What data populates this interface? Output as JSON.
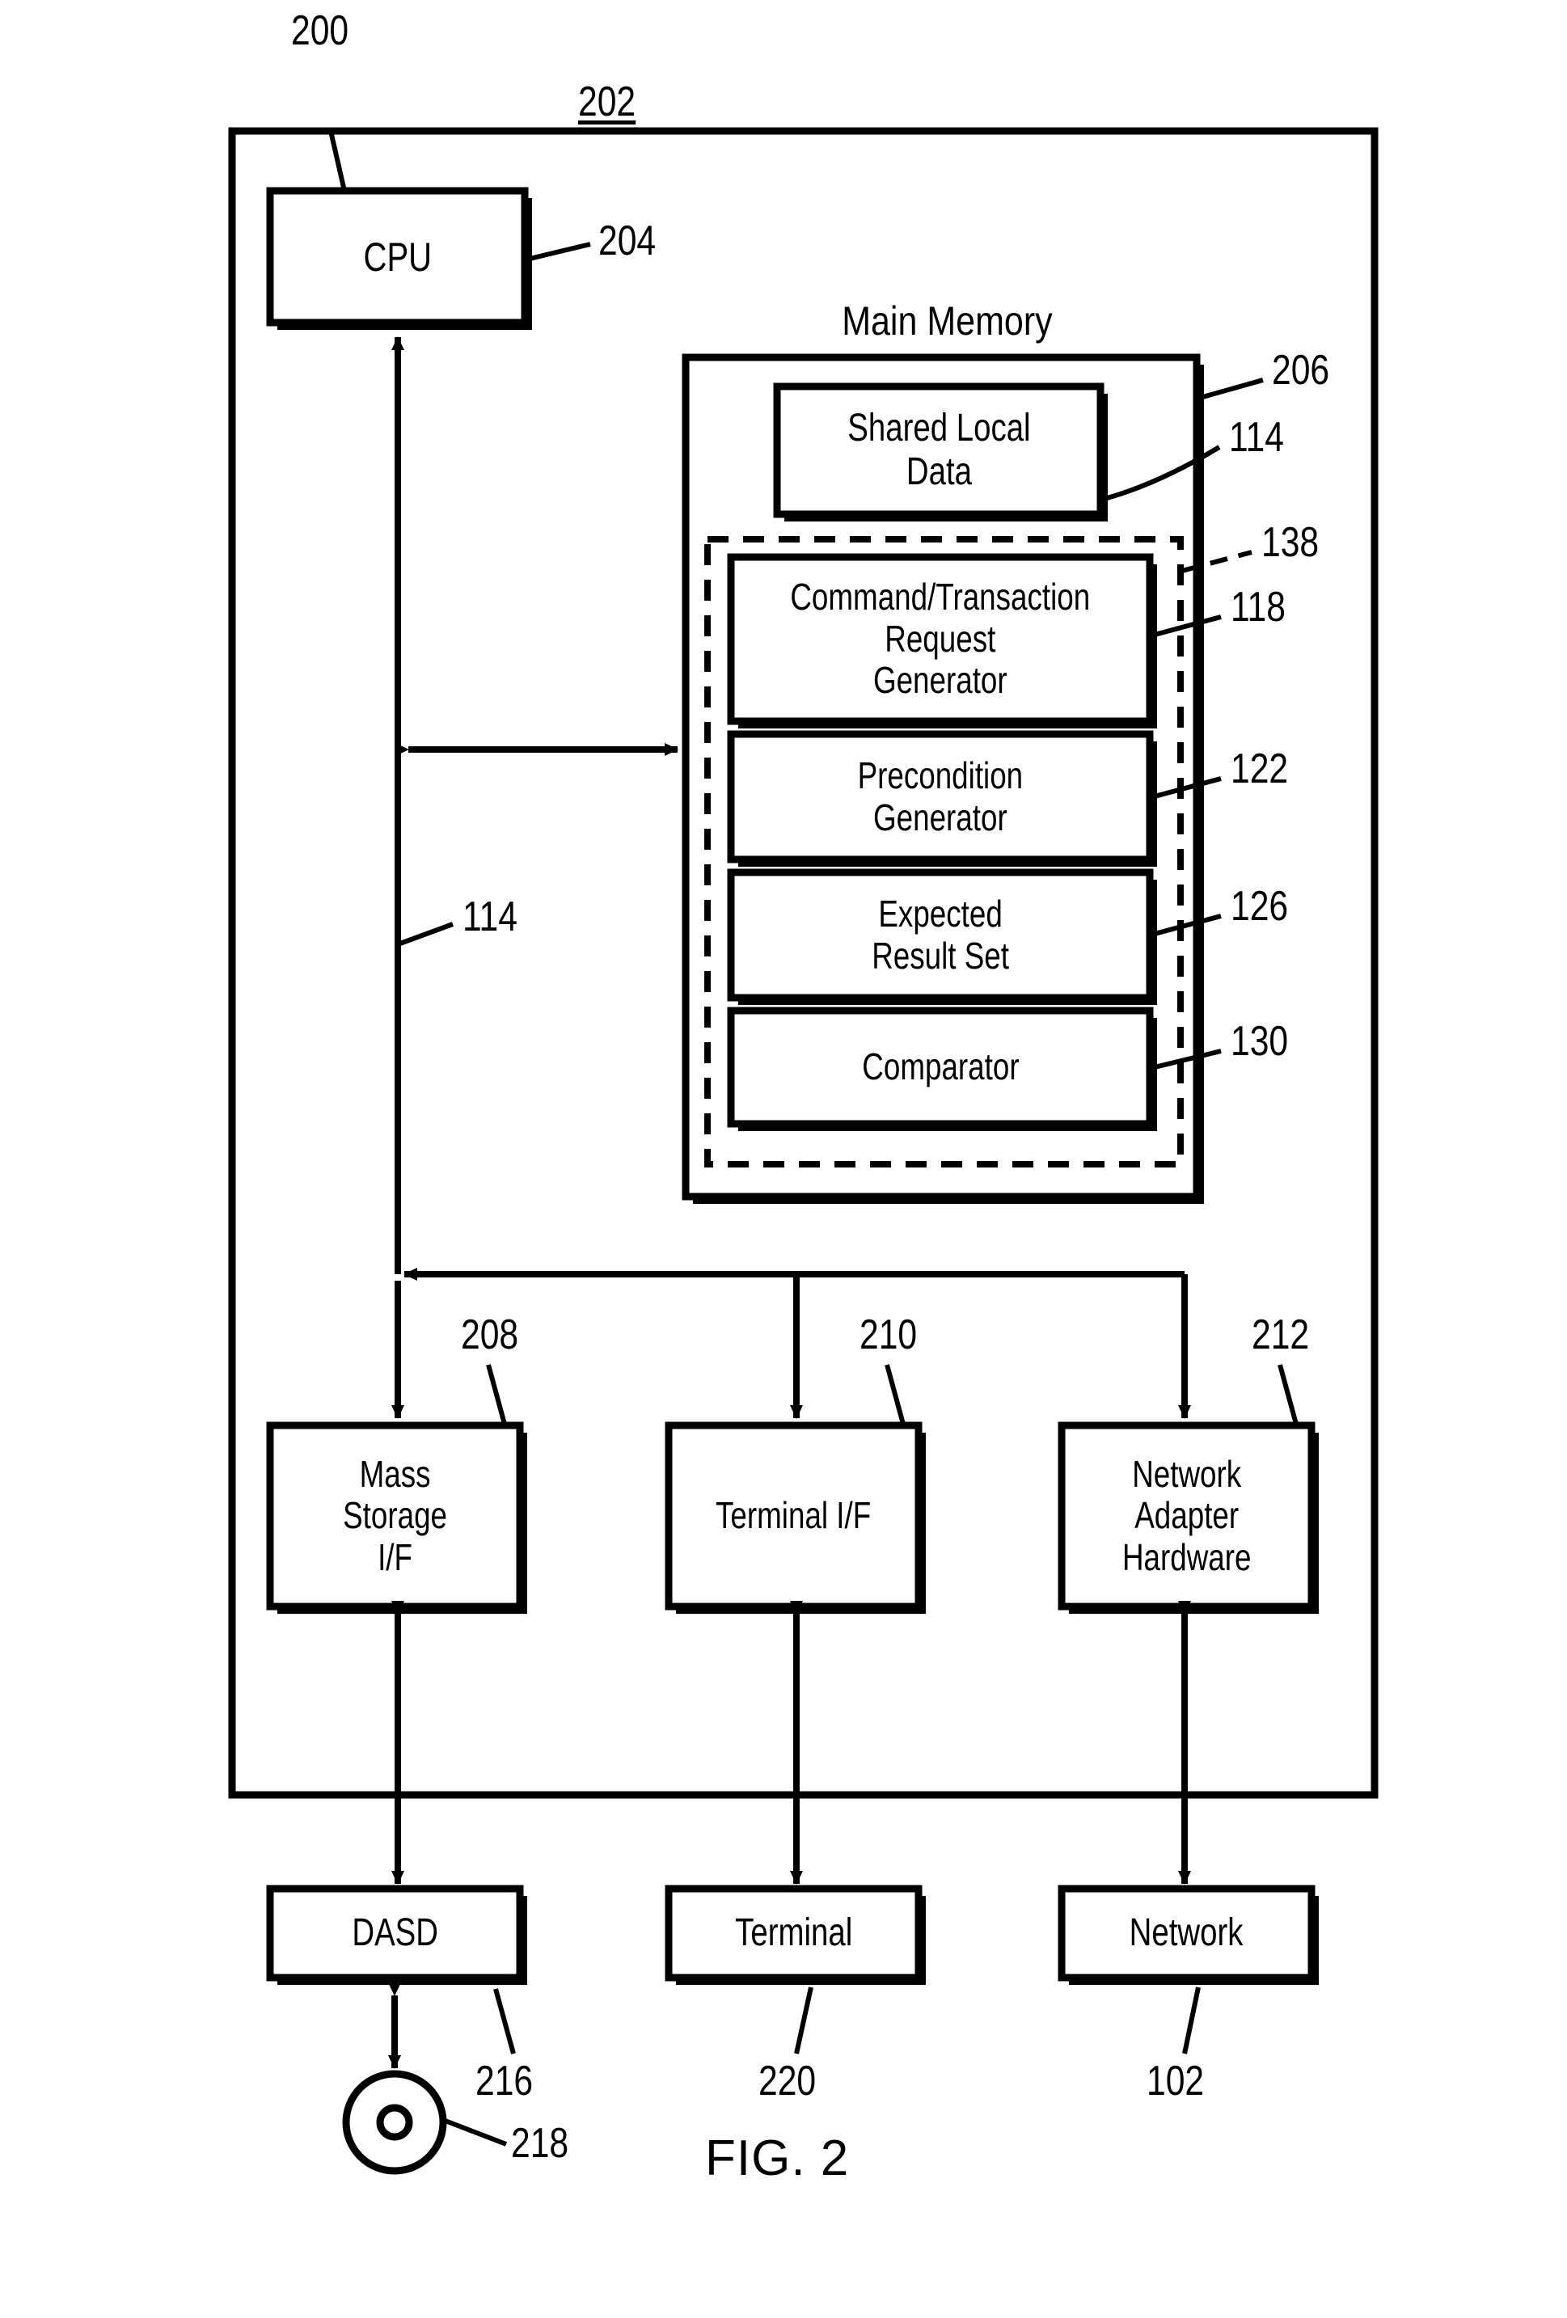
{
  "figure": {
    "caption": "FIG. 2",
    "system_ref": "200",
    "computer_system_ref": "202"
  },
  "blocks": {
    "cpu": {
      "label": "CPU",
      "ref": "204"
    },
    "main_memory": {
      "title": "Main Memory",
      "ref": "206"
    },
    "shared_local_data": {
      "label": "Shared Local\nData",
      "ref": "114"
    },
    "dashed_group": {
      "ref": "138"
    },
    "command_transaction_request_generator": {
      "label": "Command/Transaction\nRequest\nGenerator",
      "ref": "118"
    },
    "precondition_generator": {
      "label": "Precondition\nGenerator",
      "ref": "122"
    },
    "expected_result_set": {
      "label": "Expected\nResult Set",
      "ref": "126"
    },
    "comparator": {
      "label": "Comparator",
      "ref": "130"
    },
    "mass_storage_if": {
      "label": "Mass\nStorage\nI/F",
      "ref": "208"
    },
    "terminal_if": {
      "label": "Terminal I/F",
      "ref": "210"
    },
    "network_adapter_hardware": {
      "label": "Network\nAdapter\nHardware",
      "ref": "212"
    },
    "dasd": {
      "label": "DASD",
      "ref": "216"
    },
    "terminal": {
      "label": "Terminal",
      "ref": "220"
    },
    "network": {
      "label": "Network",
      "ref": "102"
    },
    "removable_media": {
      "ref": "218"
    }
  },
  "bus": {
    "ref": "114"
  },
  "colors": {
    "line": "#000000",
    "fill": "#ffffff",
    "background": "#ffffff"
  }
}
